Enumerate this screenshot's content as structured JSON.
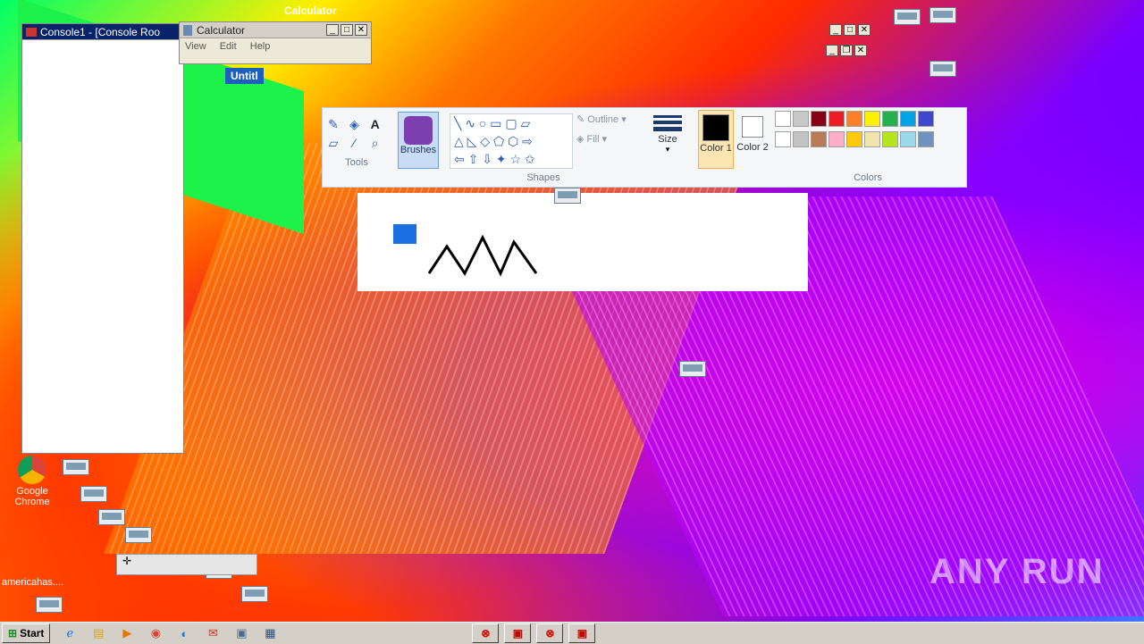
{
  "console_window": {
    "title": "Console1 - [Console Roo"
  },
  "calculator": {
    "title": "Calculator",
    "menu": [
      "View",
      "Edit",
      "Help"
    ]
  },
  "calculator_ghost_title": "Calculator",
  "paint": {
    "tab_title": "Untitl",
    "tools_label": "Tools",
    "brushes_label": "Brushes",
    "shapes_label": "Shapes",
    "outline_label": "Outline",
    "fill_label": "Fill",
    "size_label": "Size",
    "color1_label": "Color 1",
    "color2_label": "Color 2",
    "colors_label": "Colors",
    "palette_row1": [
      "#ffffff",
      "#c8c8c8",
      "#880015",
      "#ed1c24",
      "#ff7f27",
      "#fff200",
      "#22b14c",
      "#00a2e8",
      "#3f48cc"
    ],
    "palette_row2": [
      "#ffffff",
      "#c3c3c3",
      "#b97a57",
      "#ffaec9",
      "#ffc90e",
      "#efe4b0",
      "#b5e61d",
      "#99d9ea",
      "#7092be"
    ],
    "color1": "#000000",
    "color2": "#ffffff"
  },
  "desktop_icon": {
    "label_line1": "Google",
    "label_line2": "Chrome"
  },
  "desktop_text": "americahas....",
  "watermark": "ANY RUN",
  "taskbar": {
    "start_label": "Start",
    "quick_launch": [
      "ie-icon",
      "folder-icon",
      "media-player-icon",
      "chrome-icon",
      "edge-icon",
      "mail-icon",
      "window-icon",
      "save-icon"
    ]
  }
}
